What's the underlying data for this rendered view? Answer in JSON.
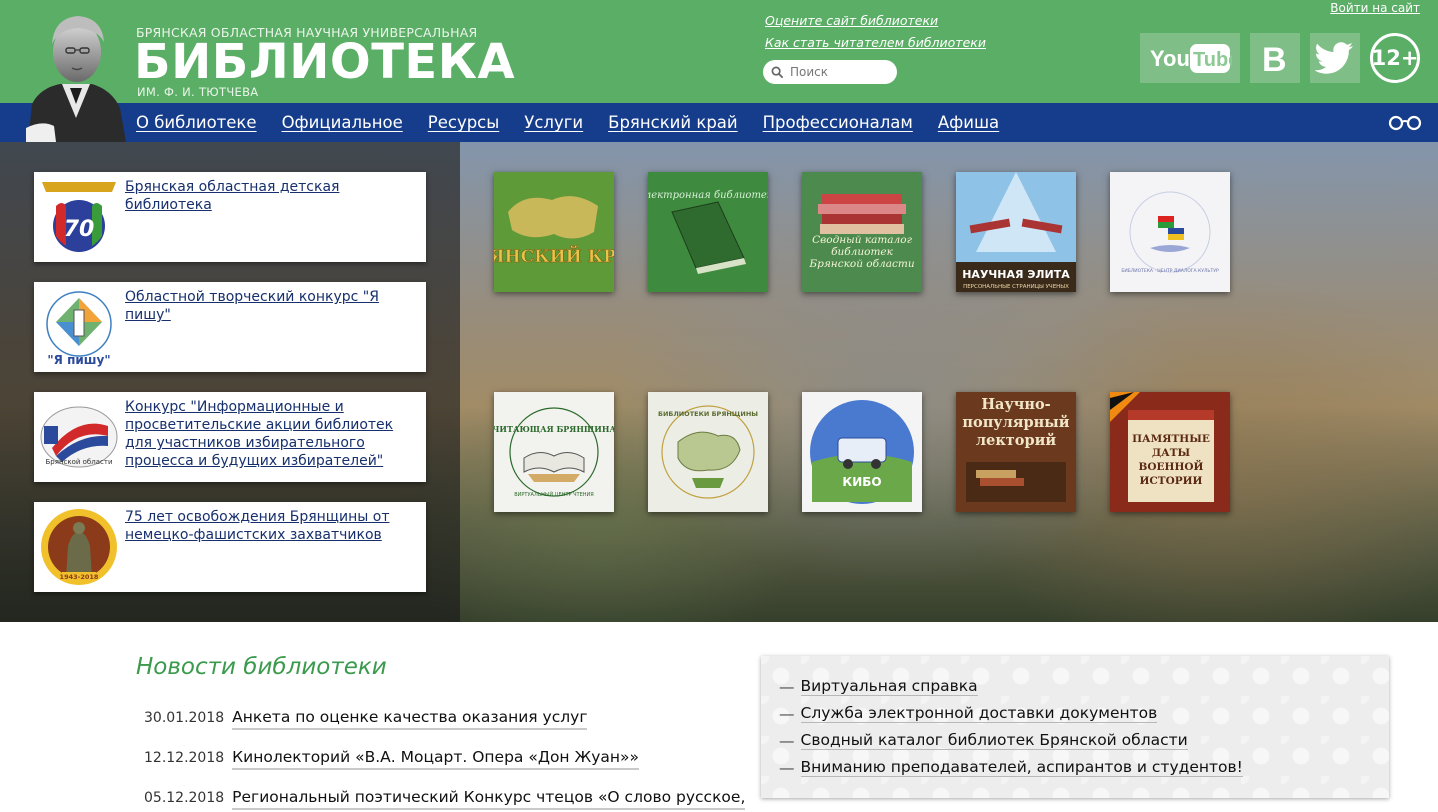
{
  "header": {
    "brand_top": "БРЯНСКАЯ ОБЛАСТНАЯ НАУЧНАЯ УНИВЕРСАЛЬНАЯ",
    "brand_main": "БИБЛИОТЕКА",
    "brand_sub": "ИМ. Ф. И. ТЮТЧЕВА",
    "link_rate": "Оцените сайт библиотеки",
    "link_reader": "Как стать читателем библиотеки",
    "login": "Войти на сайт",
    "search_placeholder": "Поиск",
    "social": {
      "youtube": "YouTube",
      "vk": "В",
      "age": "12+"
    }
  },
  "nav": {
    "items": [
      "О библиотеке",
      "Официальное",
      "Ресурсы",
      "Услуги",
      "Брянский край",
      "Профессионалам",
      "Афиша"
    ]
  },
  "cards": [
    {
      "title": "Брянская областная детская библиотека",
      "badge": "70"
    },
    {
      "title": "Областной творческий конкурс \"Я пишу\"",
      "badge": "\"Я пишу\""
    },
    {
      "title": "Конкурс \"Информационные и просветительские акции библиотек для участников избирательного процесса и будущих избирателей\"",
      "badge": "Брянской области"
    },
    {
      "title": "75 лет освобождения Брянщины от немецко-фашистских захватчиков",
      "badge": "1943-2018"
    }
  ],
  "tiles": [
    {
      "caption": "БРЯНСКИЙ КРАЙ"
    },
    {
      "caption": "Электронная библиотека"
    },
    {
      "caption": "Сводный каталог библиотек Брянской области"
    },
    {
      "caption": "НАУЧНАЯ ЭЛИТА",
      "sub": "ПЕРСОНАЛЬНЫЕ СТРАНИЦЫ УЧЕНЫХ"
    },
    {
      "caption": "БИБЛИОТЕКА · ЦЕНТР ДИАЛОГА КУЛЬТУР"
    },
    {
      "caption": "\"ЧИТАЮЩАЯ БРЯНЩИНА\"",
      "sub": "ВИРТУАЛЬНЫЙ ЦЕНТР ЧТЕНИЯ"
    },
    {
      "caption": "БИБЛИОТЕКИ БРЯНЩИНЫ"
    },
    {
      "caption": "КИБО"
    },
    {
      "caption": "Научно-популярный лекторий"
    },
    {
      "caption": "ПАМЯТНЫЕ ДАТЫ ВОЕННОЙ ИСТОРИИ"
    }
  ],
  "news": {
    "title": "Новости библиотеки",
    "items": [
      {
        "date": "30.01.2018",
        "text": "Анкета по оценке качества оказания услуг"
      },
      {
        "date": "12.12.2018",
        "text": "Кинолекторий «В.А. Моцарт. Опера «Дон Жуан»»"
      },
      {
        "date": "05.12.2018",
        "text": "Региональный поэтический Конкурс чтецов «О слово русское,"
      }
    ]
  },
  "quick_links": [
    "Виртуальная справка",
    "Служба электронной доставки документов",
    "Сводный каталог библиотек Брянской области",
    "Вниманию преподавателей, аспирантов и студентов!"
  ],
  "colors": {
    "header_green": "#5bae66",
    "nav_blue": "#163d8c",
    "news_green": "#3b9a4d"
  }
}
